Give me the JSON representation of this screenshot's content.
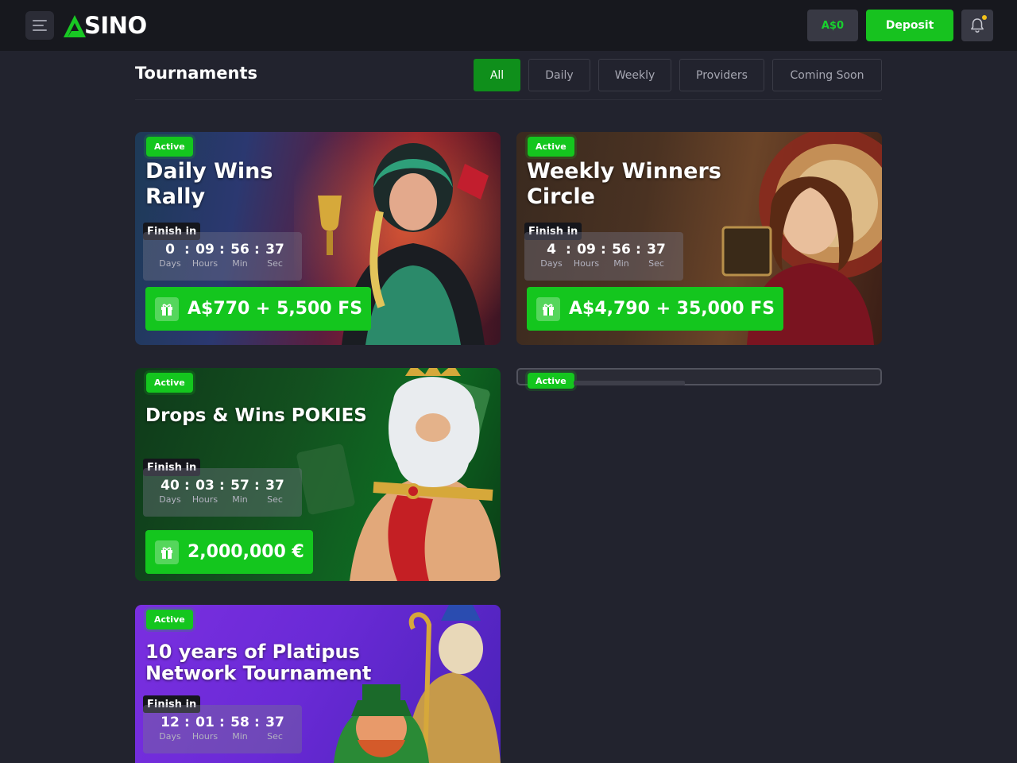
{
  "header": {
    "logo_text": "SINO",
    "balance": "A$0",
    "deposit_label": "Deposit"
  },
  "page": {
    "title": "Tournaments",
    "filters": [
      "All",
      "Daily",
      "Weekly",
      "Providers",
      "Coming Soon"
    ],
    "active_filter": "All"
  },
  "tournaments": [
    {
      "status": "Active",
      "title_line1": "Daily Wins",
      "title_line2": "Rally",
      "finish_label": "Finish in",
      "timer": {
        "days": "0",
        "hours": "09",
        "min": "56",
        "sec": "37"
      },
      "timer_labels": {
        "days": "Days",
        "hours": "Hours",
        "min": "Min",
        "sec": "Sec"
      },
      "prize": "A$770 + 5,500 FS"
    },
    {
      "status": "Active",
      "title_line1": "Weekly Winners",
      "title_line2": "Circle",
      "finish_label": "Finish in",
      "timer": {
        "days": "4",
        "hours": "09",
        "min": "56",
        "sec": "37"
      },
      "timer_labels": {
        "days": "Days",
        "hours": "Hours",
        "min": "Min",
        "sec": "Sec"
      },
      "prize": "A$4,790 + 35,000 FS"
    },
    {
      "status": "Active",
      "title_line1": "Drops & Wins POKIES",
      "title_line2": "",
      "finish_label": "Finish in",
      "timer": {
        "days": "40",
        "hours": "03",
        "min": "57",
        "sec": "37"
      },
      "timer_labels": {
        "days": "Days",
        "hours": "Hours",
        "min": "Min",
        "sec": "Sec"
      },
      "prize": "2,000,000 €"
    },
    {
      "status": "Active",
      "title_line1": "",
      "title_line2": "",
      "finish_label": "",
      "timer": {},
      "prize": ""
    },
    {
      "status": "Active",
      "title_line1": "10 years of Platipus",
      "title_line2": "Network Tournament",
      "finish_label": "Finish in",
      "timer": {
        "days": "12",
        "hours": "01",
        "min": "58",
        "sec": "37"
      },
      "timer_labels": {
        "days": "Days",
        "hours": "Hours",
        "min": "Min",
        "sec": "Sec"
      },
      "prize": ""
    }
  ],
  "colors": {
    "accent_green": "#14c61e",
    "header_bg": "#17181e",
    "page_bg": "#22232e"
  }
}
